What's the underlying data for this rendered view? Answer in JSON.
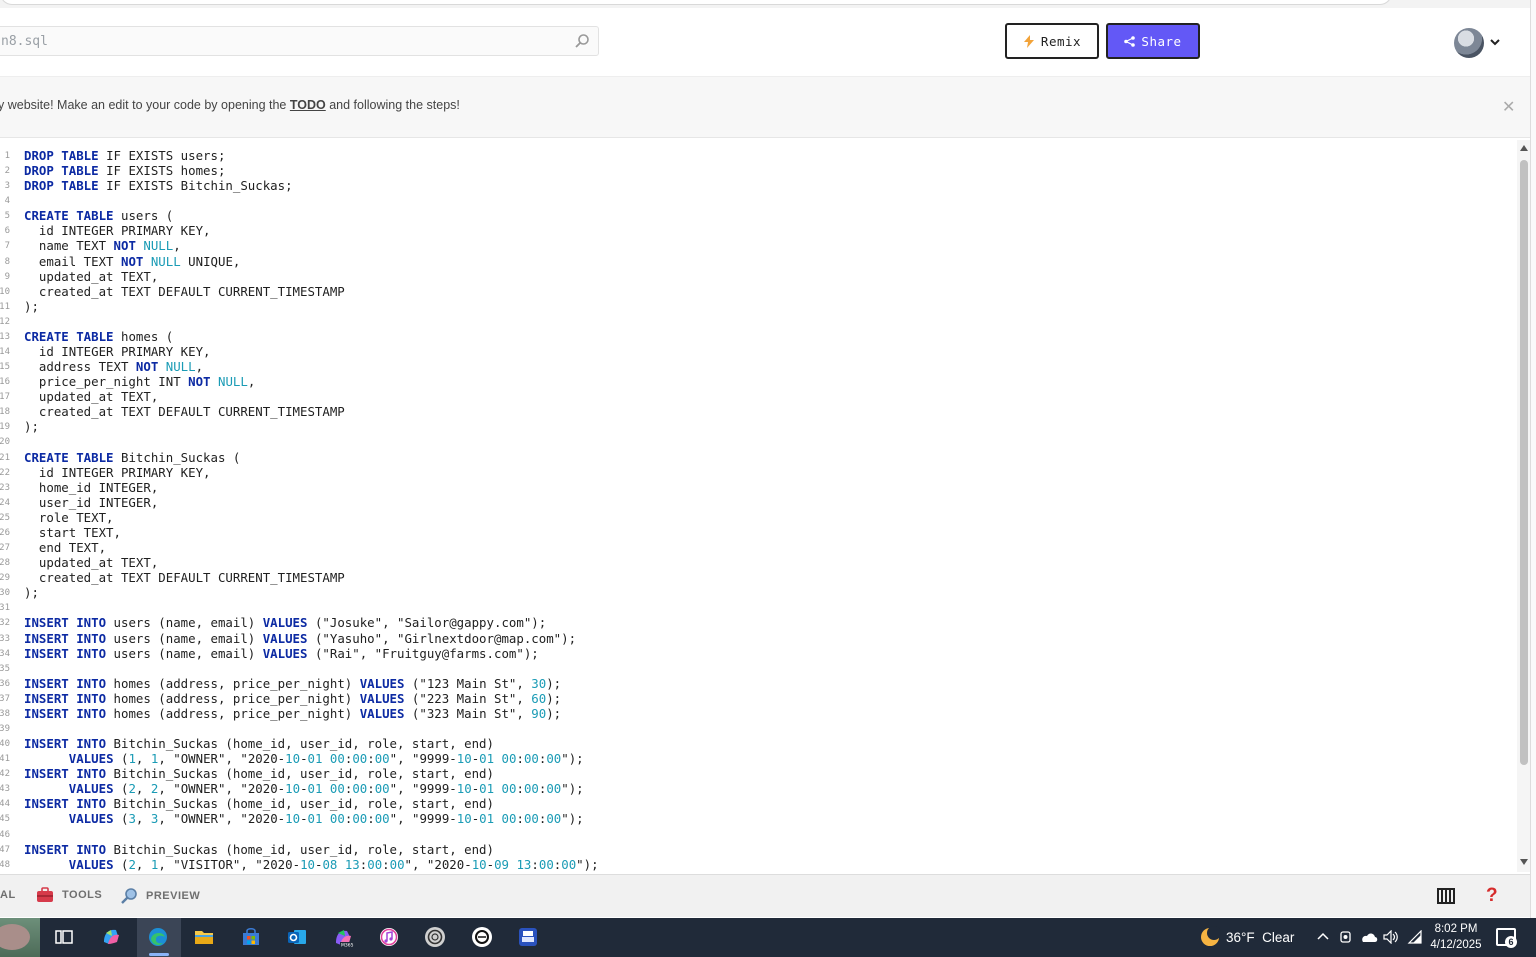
{
  "header": {
    "file_search_value": "n8.sql",
    "remix_label": "Remix",
    "share_label": "Share"
  },
  "notice": {
    "prefix": "y website! Make an edit to your code by opening the ",
    "link": "TODO",
    "suffix": " and following the steps!"
  },
  "code_lines": [
    [
      [
        "k",
        "DROP TABLE"
      ],
      [
        "t",
        " IF EXISTS users;"
      ]
    ],
    [
      [
        "k",
        "DROP TABLE"
      ],
      [
        "t",
        " IF EXISTS homes;"
      ]
    ],
    [
      [
        "k",
        "DROP TABLE"
      ],
      [
        "t",
        " IF EXISTS Bitchin_Suckas;"
      ]
    ],
    [],
    [
      [
        "k",
        "CREATE TABLE"
      ],
      [
        "t",
        " users ("
      ]
    ],
    [
      [
        "t",
        "  id INTEGER PRIMARY KEY,"
      ]
    ],
    [
      [
        "t",
        "  name TEXT "
      ],
      [
        "k",
        "NOT"
      ],
      [
        "t",
        " "
      ],
      [
        "n",
        "NULL"
      ],
      [
        "t",
        ","
      ]
    ],
    [
      [
        "t",
        "  email TEXT "
      ],
      [
        "k",
        "NOT"
      ],
      [
        "t",
        " "
      ],
      [
        "n",
        "NULL"
      ],
      [
        "t",
        " UNIQUE,"
      ]
    ],
    [
      [
        "t",
        "  updated_at TEXT,"
      ]
    ],
    [
      [
        "t",
        "  created_at TEXT DEFAULT CURRENT_TIMESTAMP"
      ]
    ],
    [
      [
        "t",
        ");"
      ]
    ],
    [],
    [
      [
        "k",
        "CREATE TABLE"
      ],
      [
        "t",
        " homes ("
      ]
    ],
    [
      [
        "t",
        "  id INTEGER PRIMARY KEY,"
      ]
    ],
    [
      [
        "t",
        "  address TEXT "
      ],
      [
        "k",
        "NOT"
      ],
      [
        "t",
        " "
      ],
      [
        "n",
        "NULL"
      ],
      [
        "t",
        ","
      ]
    ],
    [
      [
        "t",
        "  price_per_night INT "
      ],
      [
        "k",
        "NOT"
      ],
      [
        "t",
        " "
      ],
      [
        "n",
        "NULL"
      ],
      [
        "t",
        ","
      ]
    ],
    [
      [
        "t",
        "  updated_at TEXT,"
      ]
    ],
    [
      [
        "t",
        "  created_at TEXT DEFAULT CURRENT_TIMESTAMP"
      ]
    ],
    [
      [
        "t",
        ");"
      ]
    ],
    [],
    [
      [
        "k",
        "CREATE TABLE"
      ],
      [
        "t",
        " Bitchin_Suckas ("
      ]
    ],
    [
      [
        "t",
        "  id INTEGER PRIMARY KEY,"
      ]
    ],
    [
      [
        "t",
        "  home_id INTEGER,"
      ]
    ],
    [
      [
        "t",
        "  user_id INTEGER,"
      ]
    ],
    [
      [
        "t",
        "  role TEXT,"
      ]
    ],
    [
      [
        "t",
        "  start TEXT,"
      ]
    ],
    [
      [
        "t",
        "  end TEXT,"
      ]
    ],
    [
      [
        "t",
        "  updated_at TEXT,"
      ]
    ],
    [
      [
        "t",
        "  created_at TEXT DEFAULT CURRENT_TIMESTAMP"
      ]
    ],
    [
      [
        "t",
        ");"
      ]
    ],
    [],
    [
      [
        "k",
        "INSERT INTO"
      ],
      [
        "t",
        " users (name, email) "
      ],
      [
        "k",
        "VALUES"
      ],
      [
        "t",
        " (\"Josuke\", \"Sailor@gappy.com\");"
      ]
    ],
    [
      [
        "k",
        "INSERT INTO"
      ],
      [
        "t",
        " users (name, email) "
      ],
      [
        "k",
        "VALUES"
      ],
      [
        "t",
        " (\"Yasuho\", \"Girlnextdoor@map.com\");"
      ]
    ],
    [
      [
        "k",
        "INSERT INTO"
      ],
      [
        "t",
        " users (name, email) "
      ],
      [
        "k",
        "VALUES"
      ],
      [
        "t",
        " (\"Rai\", \"Fruitguy@farms.com\");"
      ]
    ],
    [],
    [
      [
        "k",
        "INSERT INTO"
      ],
      [
        "t",
        " homes (address, price_per_night) "
      ],
      [
        "k",
        "VALUES"
      ],
      [
        "t",
        " (\"123 Main St\", "
      ],
      [
        "n",
        "30"
      ],
      [
        "t",
        ");"
      ]
    ],
    [
      [
        "k",
        "INSERT INTO"
      ],
      [
        "t",
        " homes (address, price_per_night) "
      ],
      [
        "k",
        "VALUES"
      ],
      [
        "t",
        " (\"223 Main St\", "
      ],
      [
        "n",
        "60"
      ],
      [
        "t",
        ");"
      ]
    ],
    [
      [
        "k",
        "INSERT INTO"
      ],
      [
        "t",
        " homes (address, price_per_night) "
      ],
      [
        "k",
        "VALUES"
      ],
      [
        "t",
        " (\"323 Main St\", "
      ],
      [
        "n",
        "90"
      ],
      [
        "t",
        ");"
      ]
    ],
    [],
    [
      [
        "k",
        "INSERT INTO"
      ],
      [
        "t",
        " Bitchin_Suckas (home_id, user_id, role, start, end)"
      ]
    ],
    [
      [
        "t",
        "      "
      ],
      [
        "k",
        "VALUES"
      ],
      [
        "t",
        " ("
      ],
      [
        "n",
        "1"
      ],
      [
        "t",
        ", "
      ],
      [
        "n",
        "1"
      ],
      [
        "t",
        ", \"OWNER\", \"2020-"
      ],
      [
        "n",
        "10"
      ],
      [
        "t",
        "-"
      ],
      [
        "n",
        "01"
      ],
      [
        "t",
        " "
      ],
      [
        "n",
        "00"
      ],
      [
        "t",
        ":"
      ],
      [
        "n",
        "00"
      ],
      [
        "t",
        ":"
      ],
      [
        "n",
        "00"
      ],
      [
        "t",
        "\", \"9999-"
      ],
      [
        "n",
        "10"
      ],
      [
        "t",
        "-"
      ],
      [
        "n",
        "01"
      ],
      [
        "t",
        " "
      ],
      [
        "n",
        "00"
      ],
      [
        "t",
        ":"
      ],
      [
        "n",
        "00"
      ],
      [
        "t",
        ":"
      ],
      [
        "n",
        "00"
      ],
      [
        "t",
        "\");"
      ]
    ],
    [
      [
        "k",
        "INSERT INTO"
      ],
      [
        "t",
        " Bitchin_Suckas (home_id, user_id, role, start, end)"
      ]
    ],
    [
      [
        "t",
        "      "
      ],
      [
        "k",
        "VALUES"
      ],
      [
        "t",
        " ("
      ],
      [
        "n",
        "2"
      ],
      [
        "t",
        ", "
      ],
      [
        "n",
        "2"
      ],
      [
        "t",
        ", \"OWNER\", \"2020-"
      ],
      [
        "n",
        "10"
      ],
      [
        "t",
        "-"
      ],
      [
        "n",
        "01"
      ],
      [
        "t",
        " "
      ],
      [
        "n",
        "00"
      ],
      [
        "t",
        ":"
      ],
      [
        "n",
        "00"
      ],
      [
        "t",
        ":"
      ],
      [
        "n",
        "00"
      ],
      [
        "t",
        "\", \"9999-"
      ],
      [
        "n",
        "10"
      ],
      [
        "t",
        "-"
      ],
      [
        "n",
        "01"
      ],
      [
        "t",
        " "
      ],
      [
        "n",
        "00"
      ],
      [
        "t",
        ":"
      ],
      [
        "n",
        "00"
      ],
      [
        "t",
        ":"
      ],
      [
        "n",
        "00"
      ],
      [
        "t",
        "\");"
      ]
    ],
    [
      [
        "k",
        "INSERT INTO"
      ],
      [
        "t",
        " Bitchin_Suckas (home_id, user_id, role, start, end)"
      ]
    ],
    [
      [
        "t",
        "      "
      ],
      [
        "k",
        "VALUES"
      ],
      [
        "t",
        " ("
      ],
      [
        "n",
        "3"
      ],
      [
        "t",
        ", "
      ],
      [
        "n",
        "3"
      ],
      [
        "t",
        ", \"OWNER\", \"2020-"
      ],
      [
        "n",
        "10"
      ],
      [
        "t",
        "-"
      ],
      [
        "n",
        "01"
      ],
      [
        "t",
        " "
      ],
      [
        "n",
        "00"
      ],
      [
        "t",
        ":"
      ],
      [
        "n",
        "00"
      ],
      [
        "t",
        ":"
      ],
      [
        "n",
        "00"
      ],
      [
        "t",
        "\", \"9999-"
      ],
      [
        "n",
        "10"
      ],
      [
        "t",
        "-"
      ],
      [
        "n",
        "01"
      ],
      [
        "t",
        " "
      ],
      [
        "n",
        "00"
      ],
      [
        "t",
        ":"
      ],
      [
        "n",
        "00"
      ],
      [
        "t",
        ":"
      ],
      [
        "n",
        "00"
      ],
      [
        "t",
        "\");"
      ]
    ],
    [],
    [
      [
        "k",
        "INSERT INTO"
      ],
      [
        "t",
        " Bitchin_Suckas (home_id, user_id, role, start, end)"
      ]
    ],
    [
      [
        "t",
        "      "
      ],
      [
        "k",
        "VALUES"
      ],
      [
        "t",
        " ("
      ],
      [
        "n",
        "2"
      ],
      [
        "t",
        ", "
      ],
      [
        "n",
        "1"
      ],
      [
        "t",
        ", \"VISITOR\", \"2020-"
      ],
      [
        "n",
        "10"
      ],
      [
        "t",
        "-"
      ],
      [
        "n",
        "08"
      ],
      [
        "t",
        " "
      ],
      [
        "n",
        "13"
      ],
      [
        "t",
        ":"
      ],
      [
        "n",
        "00"
      ],
      [
        "t",
        ":"
      ],
      [
        "n",
        "00"
      ],
      [
        "t",
        "\", \"2020-"
      ],
      [
        "n",
        "10"
      ],
      [
        "t",
        "-"
      ],
      [
        "n",
        "09"
      ],
      [
        "t",
        " "
      ],
      [
        "n",
        "13"
      ],
      [
        "t",
        ":"
      ],
      [
        "n",
        "00"
      ],
      [
        "t",
        ":"
      ],
      [
        "n",
        "00"
      ],
      [
        "t",
        "\");"
      ]
    ]
  ],
  "bottom_bar": {
    "terminal_label": "AL",
    "tools_label": "TOOLS",
    "preview_label": "PREVIEW",
    "help_label": "?"
  },
  "taskbar": {
    "weather": "36°F  Clear",
    "time": "8:02 PM",
    "date": "4/12/2025",
    "notification_count": "6",
    "colors": {
      "background": "#202a39",
      "accent": "#6358f6"
    }
  }
}
